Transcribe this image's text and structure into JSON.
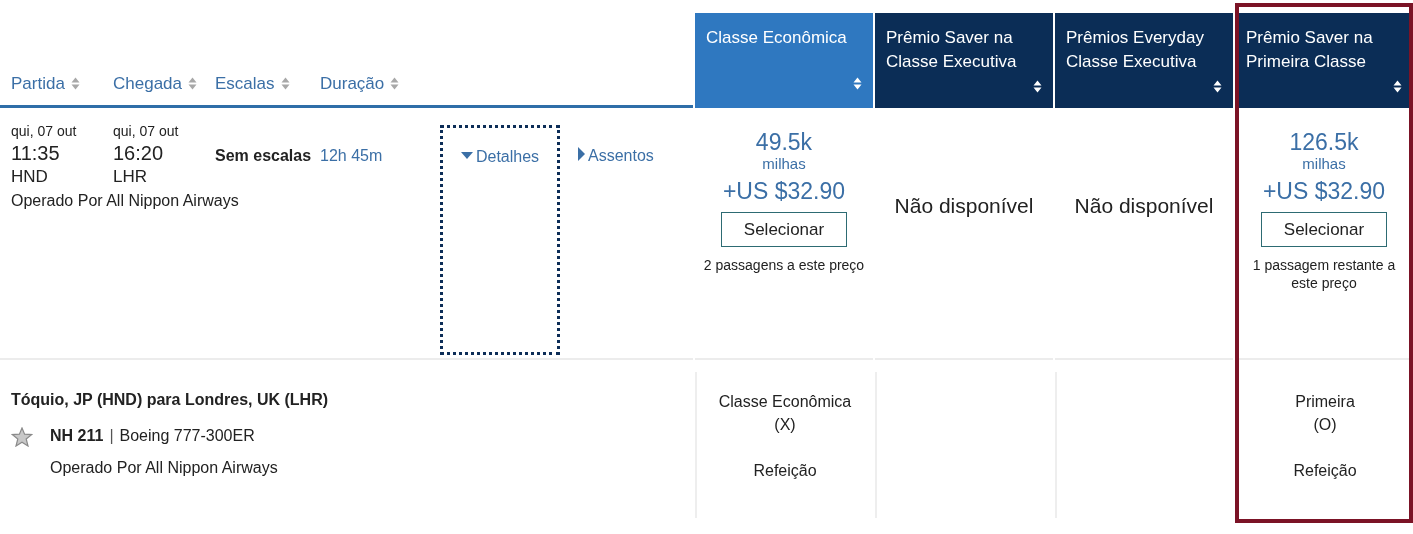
{
  "sort_headers": [
    {
      "label": "Partida"
    },
    {
      "label": "Chegada"
    },
    {
      "label": "Escalas"
    },
    {
      "label": "Duração"
    }
  ],
  "fare_columns": [
    {
      "title": "Classe Econômica",
      "selected": true,
      "highlighted": false
    },
    {
      "title": "Prêmio Saver na Classe Executiva",
      "selected": false,
      "highlighted": false
    },
    {
      "title": "Prêmios Everyday Classe Executiva",
      "selected": false,
      "highlighted": false
    },
    {
      "title": "Prêmio Saver na Primeira Classe",
      "selected": false,
      "highlighted": true
    }
  ],
  "flight": {
    "departure": {
      "date": "qui, 07 out",
      "time": "11:35",
      "airport": "HND"
    },
    "arrival": {
      "date": "qui, 07 out",
      "time": "16:20",
      "airport": "LHR"
    },
    "stops": "Sem escalas",
    "duration": "12h 45m",
    "operated_by": "Operado Por All Nippon Airways",
    "links": [
      {
        "label": "Detalhes",
        "expanded": true
      },
      {
        "label": "Assentos",
        "expanded": false
      }
    ],
    "fares": [
      {
        "kind": "price",
        "miles": "49.5k",
        "miles_unit": "milhas",
        "taxes": "+US $32.90",
        "button": "Selecionar",
        "note": "2 passagens a este preço"
      },
      {
        "kind": "unavailable",
        "text": "Não disponível"
      },
      {
        "kind": "unavailable",
        "text": "Não disponível"
      },
      {
        "kind": "price",
        "miles": "126.5k",
        "miles_unit": "milhas",
        "taxes": "+US $32.90",
        "button": "Selecionar",
        "note": "1 passagem restante a este preço"
      }
    ]
  },
  "segment": {
    "route": "Tóquio, JP (HND) para Londres, UK (LHR)",
    "flight_number": "NH 211",
    "separator": "|",
    "aircraft": "Boeing 777-300ER",
    "operated_by": "Operado Por All Nippon Airways",
    "cabins": [
      {
        "kind": "cabin",
        "cabin": "Classe Econômica",
        "code": "(X)",
        "meal": "Refeição"
      },
      {
        "kind": "empty"
      },
      {
        "kind": "empty"
      },
      {
        "kind": "cabin",
        "cabin": "Primeira",
        "code": "(O)",
        "meal": "Refeição"
      }
    ]
  }
}
